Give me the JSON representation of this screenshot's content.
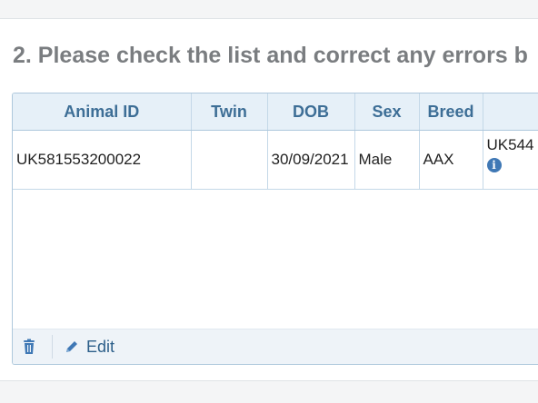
{
  "page": {
    "step_title": "2. Please check the list and correct any errors b"
  },
  "grid": {
    "columns": [
      "Animal ID",
      "Twin",
      "DOB",
      "Sex",
      "Breed",
      ""
    ],
    "rows": [
      {
        "animal_id": "UK581553200022",
        "twin": "",
        "dob": "30/09/2021",
        "sex": "Male",
        "breed": "AAX",
        "extra": "UK544"
      }
    ]
  },
  "toolbar": {
    "edit_label": "Edit"
  },
  "icons": {
    "delete": "trash-icon",
    "edit": "pencil-icon",
    "info": "info-icon"
  },
  "colors": {
    "header_text": "#3d6e96",
    "header_bg": "#e6f0f8",
    "grid_border": "#aec8dc",
    "title_text": "#7a7d80",
    "info_icon": "#3f78b5"
  }
}
